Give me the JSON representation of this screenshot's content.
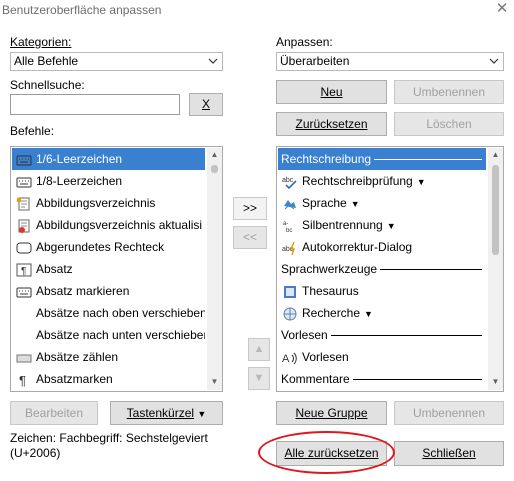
{
  "window": {
    "title": "Benutzeroberfläche anpassen",
    "close_glyph": "✕"
  },
  "left": {
    "categories_label": "Kategorien:",
    "categories_value": "Alle Befehle",
    "quicksearch_label": "Schnellsuche:",
    "quicksearch_value": "",
    "clear_label": "X",
    "commands_label": "Befehle:",
    "commands": [
      {
        "label": "1/6-Leerzeichen",
        "icon": "keyboard-icon",
        "selected": true
      },
      {
        "label": "1/8-Leerzeichen",
        "icon": "keyboard-icon",
        "selected": false
      },
      {
        "label": "Abbildungsverzeichnis",
        "icon": "figure-index-icon",
        "selected": false
      },
      {
        "label": "Abbildungsverzeichnis aktualisi",
        "icon": "update-figure-index-icon",
        "selected": false
      },
      {
        "label": "Abgerundetes Rechteck",
        "icon": "rounded-rectangle-icon",
        "selected": false
      },
      {
        "label": "Absatz",
        "icon": "paragraph-icon",
        "selected": false
      },
      {
        "label": "Absatz markieren",
        "icon": "keyboard-icon",
        "selected": false
      },
      {
        "label": "Absätze nach oben verschieben",
        "icon": "",
        "selected": false
      },
      {
        "label": "Absätze nach unten verschieben",
        "icon": "",
        "selected": false
      },
      {
        "label": "Absätze zählen",
        "icon": "count-icon",
        "selected": false
      },
      {
        "label": "Absatzmarken",
        "icon": "pilcrow-icon",
        "selected": false
      }
    ],
    "edit_label": "Bearbeiten",
    "shortcut_label": "Tastenkürzel",
    "description_line1": "Zeichen: Fachbegriff: Sechstelgeviert",
    "description_line2": "(U+2006)"
  },
  "middle": {
    "add_label": ">>",
    "remove_label": "<<",
    "up_glyph": "▲",
    "down_glyph": "▼"
  },
  "right": {
    "customize_label": "Anpassen:",
    "customize_value": "Überarbeiten",
    "new_label": "Neu",
    "rename_label": "Umbenennen",
    "reset_label": "Zurücksetzen",
    "delete_label": "Löschen",
    "items": [
      {
        "label": "Rechtschreibung",
        "type": "group",
        "selected": true
      },
      {
        "label": "Rechtschreibprüfung",
        "type": "command",
        "icon": "spellcheck-icon",
        "dropdown": true
      },
      {
        "label": "Sprache",
        "type": "command",
        "icon": "language-icon",
        "dropdown": true
      },
      {
        "label": "Silbentrennung",
        "type": "command",
        "icon": "hyphenation-icon",
        "dropdown": true
      },
      {
        "label": "Autokorrektur-Dialog",
        "type": "command",
        "icon": "autocorrect-icon",
        "dropdown": false
      },
      {
        "label": "Sprachwerkzeuge",
        "type": "group",
        "selected": false
      },
      {
        "label": "Thesaurus",
        "type": "command",
        "icon": "thesaurus-icon",
        "dropdown": false
      },
      {
        "label": "Recherche",
        "type": "command",
        "icon": "research-globe-icon",
        "dropdown": true
      },
      {
        "label": "Vorlesen",
        "type": "group",
        "selected": false
      },
      {
        "label": "Vorlesen",
        "type": "command",
        "icon": "read-aloud-icon",
        "dropdown": false
      },
      {
        "label": "Kommentare",
        "type": "group",
        "selected": false
      }
    ],
    "new_group_label": "Neue Gruppe",
    "rename2_label": "Umbenennen"
  },
  "footer": {
    "reset_all_label": "Alle zurücksetzen",
    "close_label": "Schließen"
  },
  "colors": {
    "selection": "#3a80d0",
    "highlight_circle": "#e0181c"
  }
}
